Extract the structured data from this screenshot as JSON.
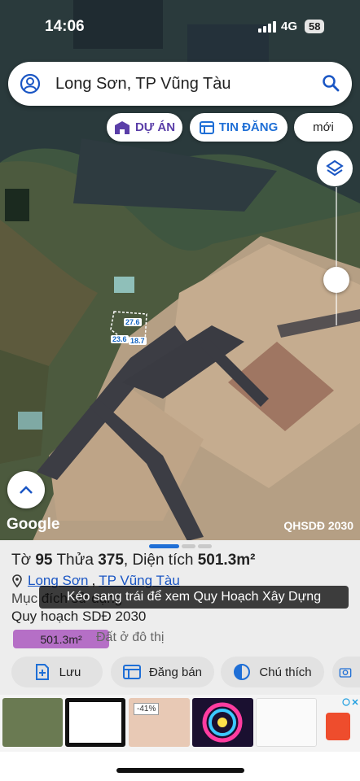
{
  "status": {
    "time": "14:06",
    "network": "4G",
    "battery": "58"
  },
  "search": {
    "text": "Long Sơn, TP Vũng Tàu"
  },
  "chips": {
    "du_an": "DỰ ÁN",
    "tin_dang": "TIN ĐĂNG",
    "moi": "mới"
  },
  "map": {
    "attribution": "Google",
    "layer_label": "QHSDĐ 2030",
    "plot_labels": [
      "27.6",
      "23.6",
      "18.7"
    ]
  },
  "parcel": {
    "to_label": "Tờ",
    "to": "95",
    "thua_label": "Thửa",
    "thua": "375",
    "dt_label": "Diện tích",
    "area": "501.3m²",
    "ward": "Long Sơn",
    "city": "TP Vũng Tàu",
    "muc_dich": "Mục đích sử dụng",
    "quy_hoach": "Quy hoạch SDĐ 2030",
    "area_badge": "501.3m²",
    "land_type": "Đất ở đô thị"
  },
  "toast": "Kéo sang trái để xem Quy Hoạch Xây Dựng",
  "actions": {
    "save": "Lưu",
    "sell": "Đăng bán",
    "note": "Chú thích"
  },
  "ad": {
    "discount": "-41%"
  },
  "colors": {
    "primary": "#1a56c4",
    "du_an": "#5a3ea8",
    "tin_dang": "#1f6fd6",
    "area_badge": "#b56fc6"
  }
}
